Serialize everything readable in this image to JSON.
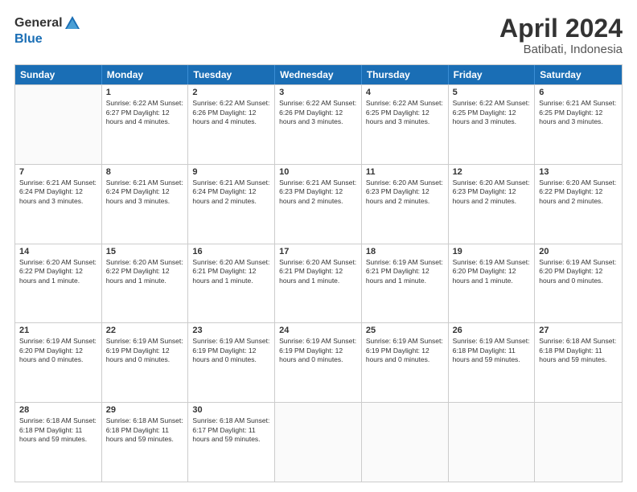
{
  "header": {
    "logo_general": "General",
    "logo_blue": "Blue",
    "month": "April 2024",
    "location": "Batibati, Indonesia"
  },
  "days_of_week": [
    "Sunday",
    "Monday",
    "Tuesday",
    "Wednesday",
    "Thursday",
    "Friday",
    "Saturday"
  ],
  "weeks": [
    [
      {
        "day": "",
        "info": ""
      },
      {
        "day": "1",
        "info": "Sunrise: 6:22 AM\nSunset: 6:27 PM\nDaylight: 12 hours\nand 4 minutes."
      },
      {
        "day": "2",
        "info": "Sunrise: 6:22 AM\nSunset: 6:26 PM\nDaylight: 12 hours\nand 4 minutes."
      },
      {
        "day": "3",
        "info": "Sunrise: 6:22 AM\nSunset: 6:26 PM\nDaylight: 12 hours\nand 3 minutes."
      },
      {
        "day": "4",
        "info": "Sunrise: 6:22 AM\nSunset: 6:25 PM\nDaylight: 12 hours\nand 3 minutes."
      },
      {
        "day": "5",
        "info": "Sunrise: 6:22 AM\nSunset: 6:25 PM\nDaylight: 12 hours\nand 3 minutes."
      },
      {
        "day": "6",
        "info": "Sunrise: 6:21 AM\nSunset: 6:25 PM\nDaylight: 12 hours\nand 3 minutes."
      }
    ],
    [
      {
        "day": "7",
        "info": "Sunrise: 6:21 AM\nSunset: 6:24 PM\nDaylight: 12 hours\nand 3 minutes."
      },
      {
        "day": "8",
        "info": "Sunrise: 6:21 AM\nSunset: 6:24 PM\nDaylight: 12 hours\nand 3 minutes."
      },
      {
        "day": "9",
        "info": "Sunrise: 6:21 AM\nSunset: 6:24 PM\nDaylight: 12 hours\nand 2 minutes."
      },
      {
        "day": "10",
        "info": "Sunrise: 6:21 AM\nSunset: 6:23 PM\nDaylight: 12 hours\nand 2 minutes."
      },
      {
        "day": "11",
        "info": "Sunrise: 6:20 AM\nSunset: 6:23 PM\nDaylight: 12 hours\nand 2 minutes."
      },
      {
        "day": "12",
        "info": "Sunrise: 6:20 AM\nSunset: 6:23 PM\nDaylight: 12 hours\nand 2 minutes."
      },
      {
        "day": "13",
        "info": "Sunrise: 6:20 AM\nSunset: 6:22 PM\nDaylight: 12 hours\nand 2 minutes."
      }
    ],
    [
      {
        "day": "14",
        "info": "Sunrise: 6:20 AM\nSunset: 6:22 PM\nDaylight: 12 hours\nand 1 minute."
      },
      {
        "day": "15",
        "info": "Sunrise: 6:20 AM\nSunset: 6:22 PM\nDaylight: 12 hours\nand 1 minute."
      },
      {
        "day": "16",
        "info": "Sunrise: 6:20 AM\nSunset: 6:21 PM\nDaylight: 12 hours\nand 1 minute."
      },
      {
        "day": "17",
        "info": "Sunrise: 6:20 AM\nSunset: 6:21 PM\nDaylight: 12 hours\nand 1 minute."
      },
      {
        "day": "18",
        "info": "Sunrise: 6:19 AM\nSunset: 6:21 PM\nDaylight: 12 hours\nand 1 minute."
      },
      {
        "day": "19",
        "info": "Sunrise: 6:19 AM\nSunset: 6:20 PM\nDaylight: 12 hours\nand 1 minute."
      },
      {
        "day": "20",
        "info": "Sunrise: 6:19 AM\nSunset: 6:20 PM\nDaylight: 12 hours\nand 0 minutes."
      }
    ],
    [
      {
        "day": "21",
        "info": "Sunrise: 6:19 AM\nSunset: 6:20 PM\nDaylight: 12 hours\nand 0 minutes."
      },
      {
        "day": "22",
        "info": "Sunrise: 6:19 AM\nSunset: 6:19 PM\nDaylight: 12 hours\nand 0 minutes."
      },
      {
        "day": "23",
        "info": "Sunrise: 6:19 AM\nSunset: 6:19 PM\nDaylight: 12 hours\nand 0 minutes."
      },
      {
        "day": "24",
        "info": "Sunrise: 6:19 AM\nSunset: 6:19 PM\nDaylight: 12 hours\nand 0 minutes."
      },
      {
        "day": "25",
        "info": "Sunrise: 6:19 AM\nSunset: 6:19 PM\nDaylight: 12 hours\nand 0 minutes."
      },
      {
        "day": "26",
        "info": "Sunrise: 6:19 AM\nSunset: 6:18 PM\nDaylight: 11 hours\nand 59 minutes."
      },
      {
        "day": "27",
        "info": "Sunrise: 6:18 AM\nSunset: 6:18 PM\nDaylight: 11 hours\nand 59 minutes."
      }
    ],
    [
      {
        "day": "28",
        "info": "Sunrise: 6:18 AM\nSunset: 6:18 PM\nDaylight: 11 hours\nand 59 minutes."
      },
      {
        "day": "29",
        "info": "Sunrise: 6:18 AM\nSunset: 6:18 PM\nDaylight: 11 hours\nand 59 minutes."
      },
      {
        "day": "30",
        "info": "Sunrise: 6:18 AM\nSunset: 6:17 PM\nDaylight: 11 hours\nand 59 minutes."
      },
      {
        "day": "",
        "info": ""
      },
      {
        "day": "",
        "info": ""
      },
      {
        "day": "",
        "info": ""
      },
      {
        "day": "",
        "info": ""
      }
    ]
  ]
}
